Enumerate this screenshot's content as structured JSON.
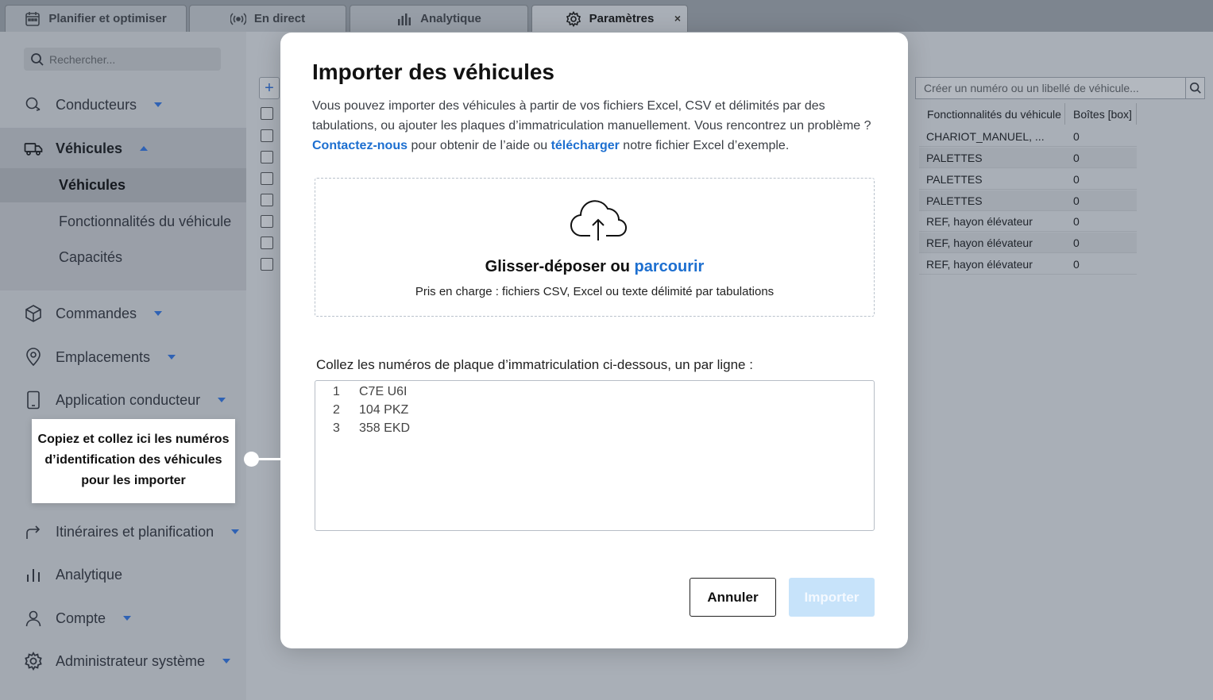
{
  "tabs": [
    {
      "label": "Planifier et optimiser",
      "icon": "calendar-icon"
    },
    {
      "label": "En direct",
      "icon": "broadcast-icon"
    },
    {
      "label": "Analytique",
      "icon": "bar-chart-icon"
    },
    {
      "label": "Paramètres",
      "icon": "gear-icon",
      "active": true,
      "close": "×"
    }
  ],
  "sidebar": {
    "search_placeholder": "Rechercher...",
    "items": [
      {
        "label": "Conducteurs",
        "icon": "driver-icon"
      },
      {
        "label": "Véhicules",
        "icon": "truck-icon",
        "expanded": true
      },
      {
        "label": "Commandes",
        "icon": "package-icon"
      },
      {
        "label": "Emplacements",
        "icon": "location-pin-icon"
      },
      {
        "label": "Application conducteur",
        "icon": "phone-icon"
      },
      {
        "label": "Itinéraires et planification",
        "icon": "route-arrow-icon"
      },
      {
        "label": "Analytique",
        "icon": "bar-chart-icon"
      },
      {
        "label": "Compte",
        "icon": "user-icon"
      },
      {
        "label": "Administrateur système",
        "icon": "gear-icon"
      }
    ],
    "sub_items": [
      "Véhicules",
      "Fonctionnalités du véhicule",
      "Capacités"
    ]
  },
  "table": {
    "add_label": "+",
    "search_placeholder": "Créer un numéro ou un libellé de véhicule...",
    "headers": [
      "Fonctionnalités du véhicule",
      "Boîtes [box]"
    ],
    "rows": [
      [
        "CHARIOT_MANUEL, ...",
        "0"
      ],
      [
        "PALETTES",
        "0"
      ],
      [
        "PALETTES",
        "0"
      ],
      [
        "PALETTES",
        "0"
      ],
      [
        "REF, hayon élévateur",
        "0"
      ],
      [
        "REF, hayon élévateur",
        "0"
      ],
      [
        "REF, hayon élévateur",
        "0"
      ]
    ]
  },
  "modal": {
    "title": "Importer des véhicules",
    "desc_part1": "Vous pouvez importer des véhicules à partir de vos fichiers Excel, CSV et délimités par des tabulations, ou ajouter les plaques d’immatriculation manuellement. Vous rencontrez un problème ?",
    "contact_link": "Contactez-nous",
    "desc_part2": " pour obtenir de l’aide ou ",
    "download_link": "télécharger",
    "desc_part3": " notre fichier Excel d’exemple.",
    "dropzone": {
      "main_text": "Glisser-déposer ou ",
      "browse_link": "parcourir",
      "sub_text": "Pris en charge : fichiers CSV, Excel ou texte délimité par tabulations"
    },
    "paste_label": "Collez les numéros de plaque d’immatriculation ci-dessous, un par ligne :",
    "plates": [
      {
        "n": "1",
        "value": "C7E U6I"
      },
      {
        "n": "2",
        "value": "104 PKZ"
      },
      {
        "n": "3",
        "value": "358 EKD"
      }
    ],
    "cancel_label": "Annuler",
    "import_label": "Importer"
  },
  "callout": {
    "text": "Copiez et collez ici les numéros d’identification des véhicules pour les importer"
  },
  "colors": {
    "link": "#1d6fd0",
    "import_disabled": "#c7e3fa",
    "caret": "#2f62b4"
  }
}
